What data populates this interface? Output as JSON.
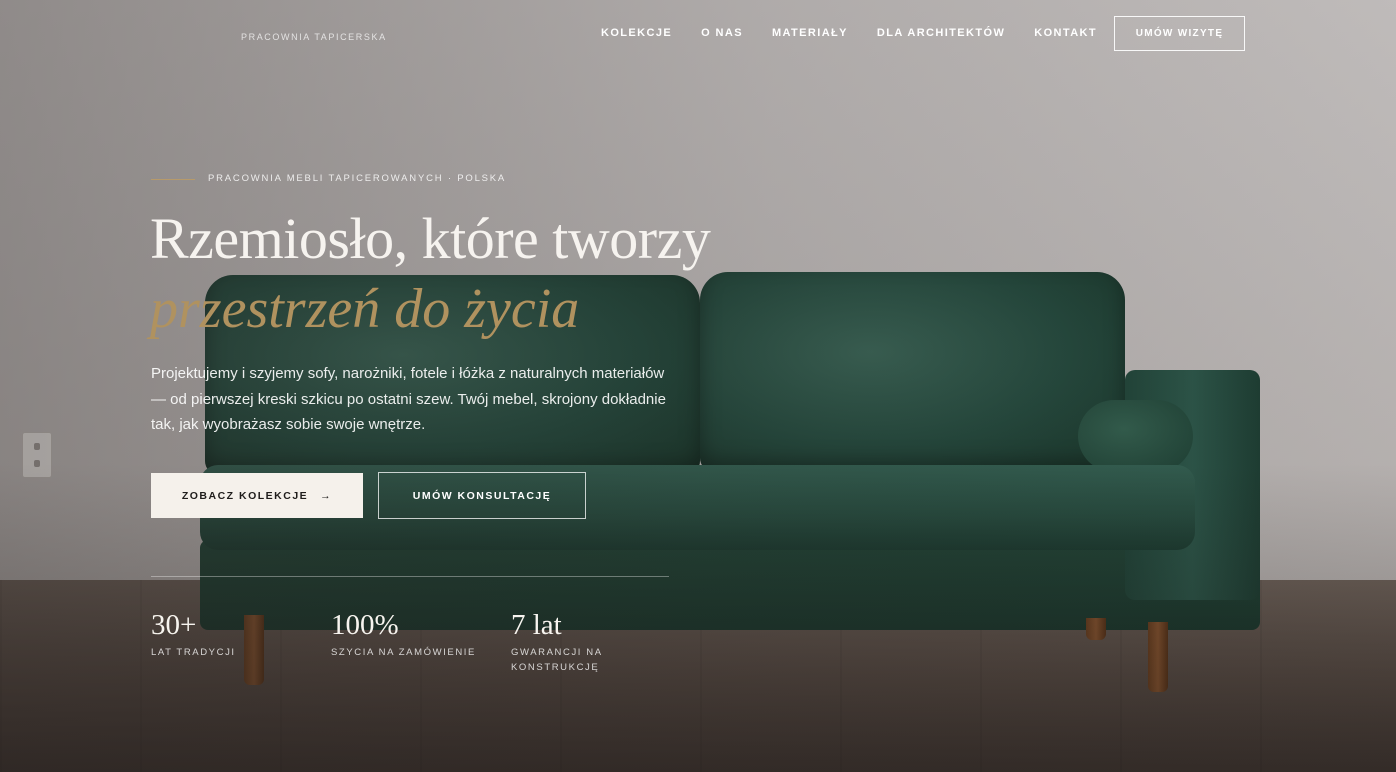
{
  "header": {
    "brand": "PRACOWNIA TAPICERSKA",
    "nav": [
      "KOLEKCJE",
      "O NAS",
      "MATERIAŁY",
      "DLA ARCHITEKTÓW",
      "KONTAKT"
    ],
    "cta": "UMÓW WIZYTĘ"
  },
  "hero": {
    "eyebrow": "PRACOWNIA MEBLI TAPICEROWANYCH · POLSKA",
    "title": "Rzemiosło, które tworzy",
    "title_accent": "przestrzeń do życia",
    "description": "Projektujemy i szyjemy sofy, narożniki, fotele i łóżka z naturalnych materiałów — od pierwszej kreski szkicu po ostatni szew. Twój mebel, skrojony dokładnie tak, jak wyobrażasz sobie swoje wnętrze.",
    "primary_button": "ZOBACZ KOLEKCJE",
    "primary_button_arrow": "→",
    "secondary_button": "UMÓW KONSULTACJĘ"
  },
  "stats": [
    {
      "value": "30+",
      "label": "LAT TRADYCJI"
    },
    {
      "value": "100%",
      "label": "SZYCIA NA ZAMÓWIENIE"
    },
    {
      "value": "7 lat",
      "label": "GWARANCJI NA KONSTRUKCJĘ"
    }
  ],
  "colors": {
    "accent_gold": "#b0925f",
    "sofa_green": "#244a3e",
    "button_light": "#f5f1eb"
  }
}
